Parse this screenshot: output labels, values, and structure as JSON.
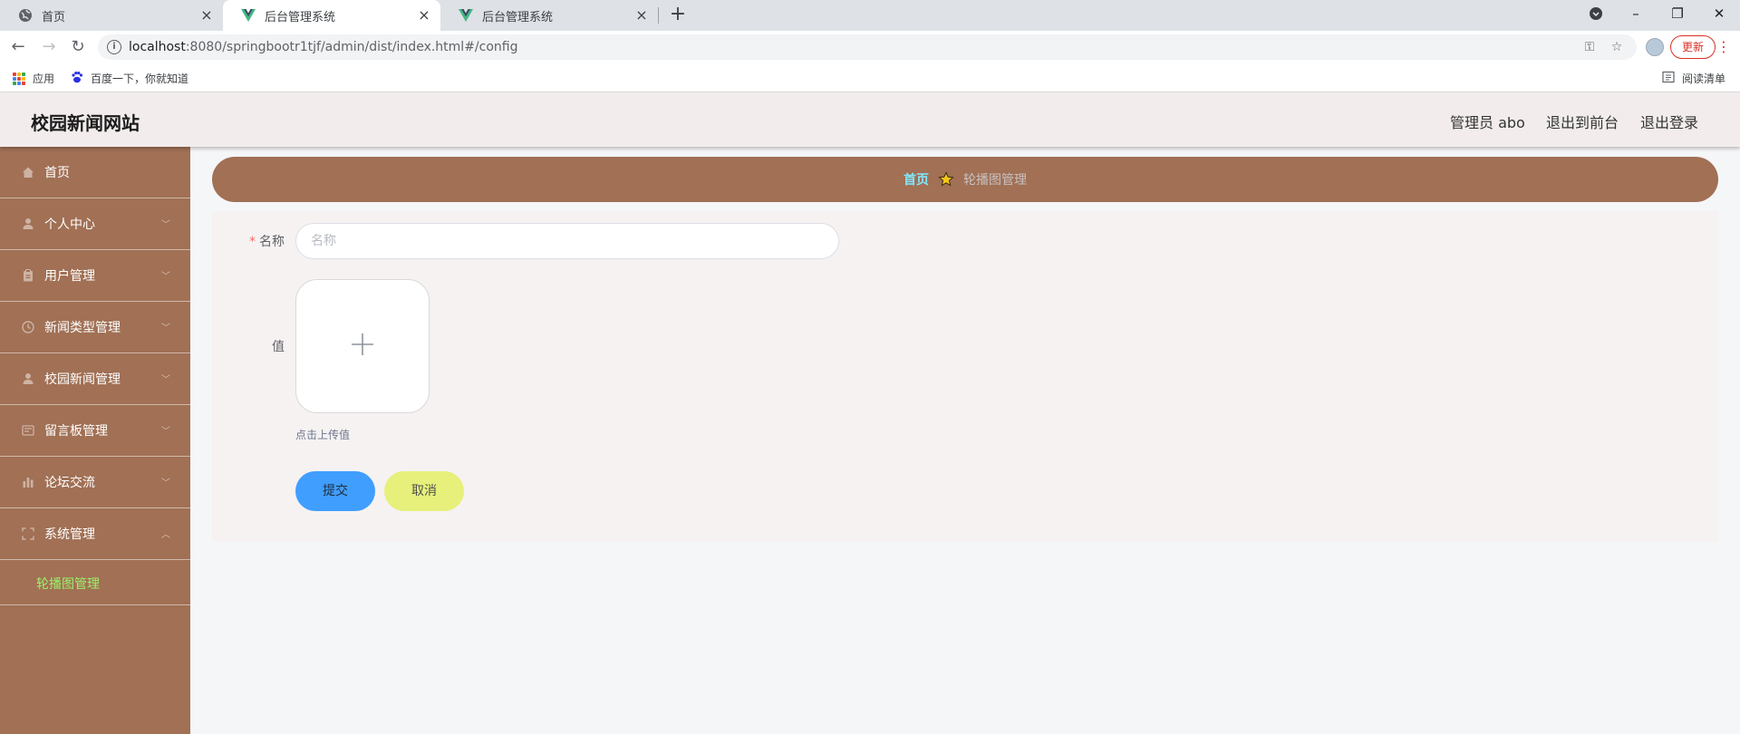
{
  "browser": {
    "tabs": [
      {
        "label": "首页",
        "icon": "globe-icon"
      },
      {
        "label": "后台管理系统",
        "icon": "vue-logo-icon"
      },
      {
        "label": "后台管理系统",
        "icon": "vue-logo-icon"
      }
    ],
    "url_host": "localhost",
    "url_rest": ":8080/springbootr1tjf/admin/dist/index.html#/config",
    "update_label": "更新",
    "bookmarks": [
      {
        "label": "应用",
        "icon": "apps-grid-icon"
      },
      {
        "label": "百度一下，你就知道",
        "icon": "baidu-paw-icon"
      }
    ],
    "reading_list": "阅读清单"
  },
  "header": {
    "site_title": "校园新闻网站",
    "user_label": "管理员 abo",
    "to_frontend": "退出到前台",
    "logout": "退出登录"
  },
  "sidebar": {
    "items": [
      {
        "label": "首页",
        "icon": "home-icon"
      },
      {
        "label": "个人中心",
        "icon": "user-icon"
      },
      {
        "label": "用户管理",
        "icon": "clipboard-icon"
      },
      {
        "label": "新闻类型管理",
        "icon": "clock-icon"
      },
      {
        "label": "校园新闻管理",
        "icon": "user-icon"
      },
      {
        "label": "留言板管理",
        "icon": "message-icon"
      },
      {
        "label": "论坛交流",
        "icon": "bar-chart-icon"
      },
      {
        "label": "系统管理",
        "icon": "fullscreen-icon"
      }
    ],
    "sub_items": [
      {
        "label": "轮播图管理"
      }
    ]
  },
  "breadcrumb": {
    "home": "首页",
    "current": "轮播图管理"
  },
  "form": {
    "name_label": "名称",
    "name_placeholder": "名称",
    "name_value": "",
    "value_label": "值",
    "upload_hint": "点击上传值",
    "submit_label": "提交",
    "cancel_label": "取消"
  },
  "colors": {
    "sidebar_bg": "#a17055",
    "header_bg": "#f2ecec",
    "active_submenu": "#9ef06a",
    "breadcrumb_home": "#7fe8ff",
    "submit_bg": "#409eff",
    "cancel_bg": "#e6f07a"
  }
}
